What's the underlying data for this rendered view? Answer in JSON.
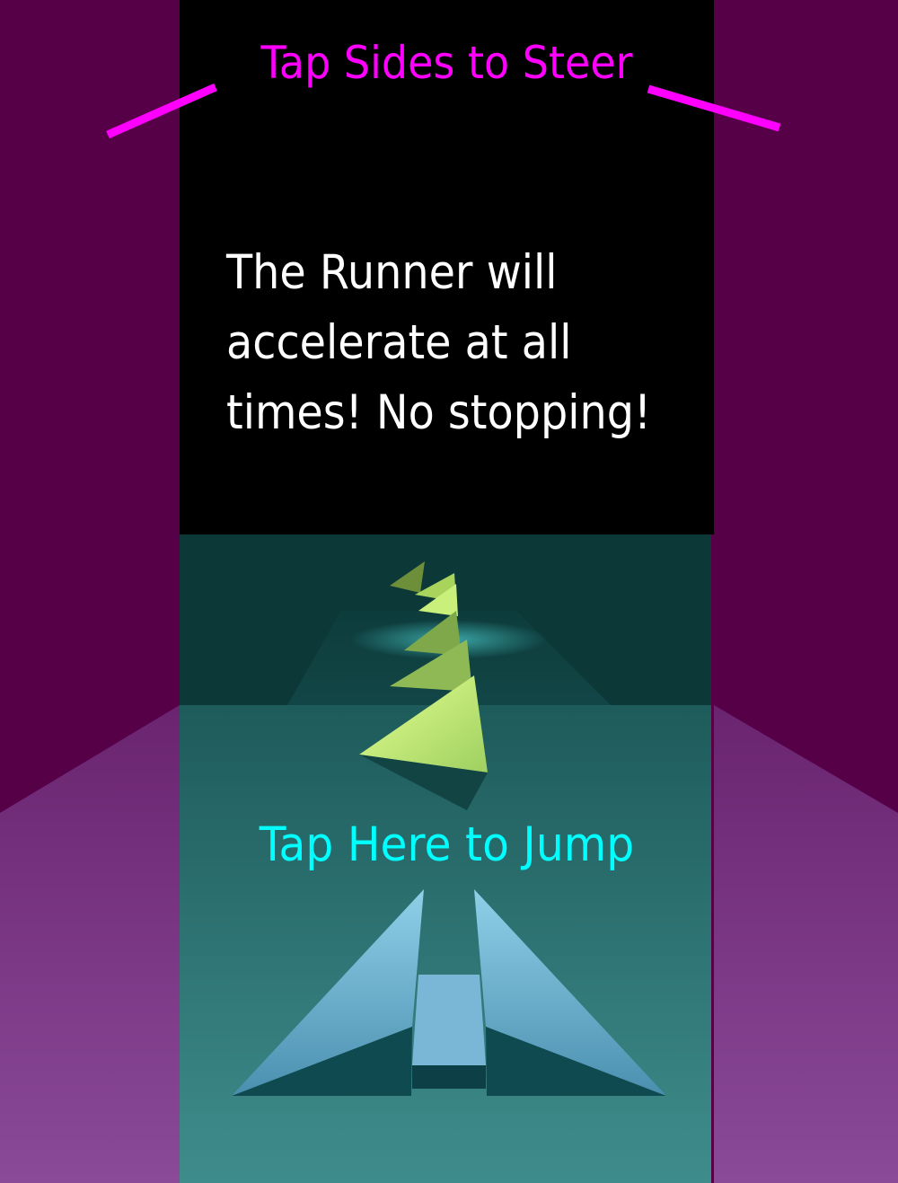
{
  "hints": {
    "steer": "Tap Sides to Steer",
    "jump": "Tap Here to Jump"
  },
  "message": {
    "line1": "The Runner will",
    "line2": "accelerate at all",
    "line3": "times! No stopping!"
  },
  "colors": {
    "steer_text": "#ff00ff",
    "steer_marker": "#ff00ff",
    "jump_text": "#00ffff",
    "message_text": "#ffffff",
    "side_panel_dark": "#560048",
    "side_panel_light": "#7b3585",
    "center_panel": "#000000",
    "track": "#1f5f5f",
    "runner_obstacle": "#c8f07a",
    "ramp": "#5aa6c4"
  }
}
